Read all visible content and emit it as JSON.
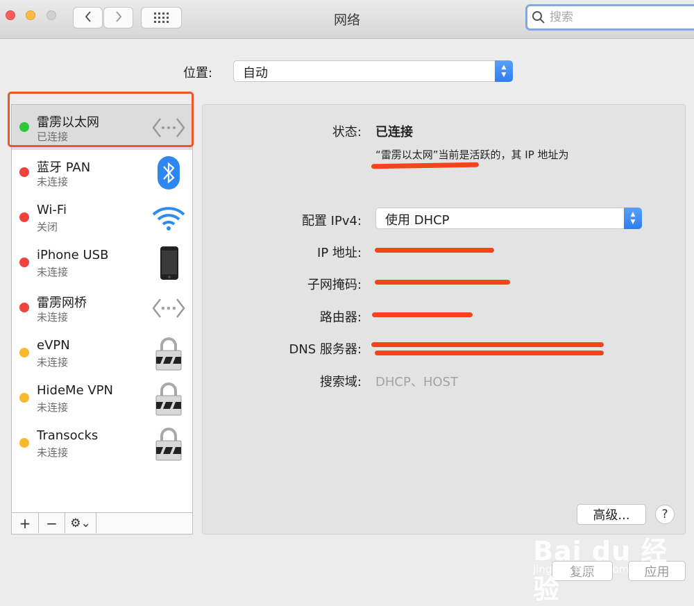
{
  "window": {
    "title": "网络",
    "search_placeholder": "搜索",
    "back_glyph": "‹",
    "forward_glyph": "›"
  },
  "location": {
    "label": "位置:",
    "value": "自动"
  },
  "services": [
    {
      "name": "雷雳以太网",
      "status": "已连接",
      "dot_color": "#2fc43a",
      "icon": "thunderbolt-ethernet-icon",
      "selected": true
    },
    {
      "name": "蓝牙 PAN",
      "status": "未连接",
      "dot_color": "#f0423c",
      "icon": "bluetooth-icon",
      "selected": false
    },
    {
      "name": "Wi-Fi",
      "status": "关闭",
      "dot_color": "#f0423c",
      "icon": "wifi-icon",
      "selected": false
    },
    {
      "name": "iPhone USB",
      "status": "未连接",
      "dot_color": "#f0423c",
      "icon": "iphone-icon",
      "selected": false
    },
    {
      "name": "雷雳网桥",
      "status": "未连接",
      "dot_color": "#f0423c",
      "icon": "thunderbolt-bridge-icon",
      "selected": false
    },
    {
      "name": "eVPN",
      "status": "未连接",
      "dot_color": "#f8b92c",
      "icon": "vpn-lock-icon",
      "selected": false
    },
    {
      "name": "HideMe VPN",
      "status": "未连接",
      "dot_color": "#f8b92c",
      "icon": "vpn-lock-icon",
      "selected": false
    },
    {
      "name": "Transocks",
      "status": "未连接",
      "dot_color": "#f8b92c",
      "icon": "vpn-lock-icon",
      "selected": false
    }
  ],
  "sidebar_toolbar": {
    "add": "+",
    "remove": "−",
    "action": "⚙︎⌄"
  },
  "details": {
    "status_label": "状态:",
    "status_value": "已连接",
    "status_desc": "“雷雳以太网”当前是活跃的，其 IP 地址为",
    "configure_label": "配置 IPv4:",
    "configure_value": "使用 DHCP",
    "ip_label": "IP 地址:",
    "subnet_label": "子网掩码:",
    "router_label": "路由器:",
    "dns_label": "DNS 服务器:",
    "search_domain_label": "搜索域:",
    "search_domain_value": "DHCP、HOST"
  },
  "buttons": {
    "advanced": "高级...",
    "help": "?",
    "revert": "复原",
    "apply": "应用"
  },
  "watermark": {
    "brand": "Bai du 经验",
    "url": "jingyan.baidu.com"
  },
  "colors": {
    "redaction": "#f4441e",
    "highlight": "#f0532a",
    "accent": "#2f7ef1"
  }
}
